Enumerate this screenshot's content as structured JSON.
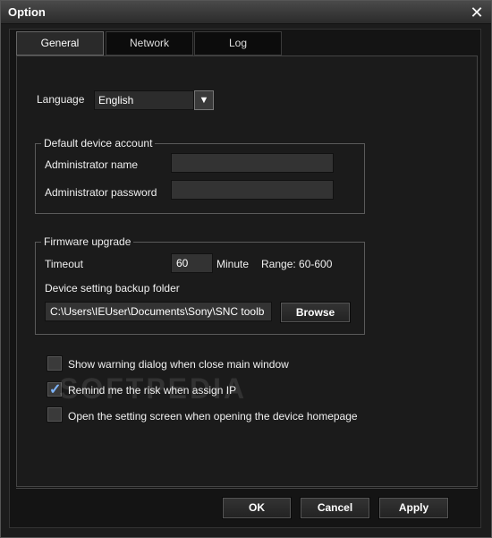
{
  "window": {
    "title": "Option",
    "close_symbol": "✕"
  },
  "tabs": [
    {
      "label": "General",
      "active": true
    },
    {
      "label": "Network",
      "active": false
    },
    {
      "label": "Log",
      "active": false
    }
  ],
  "language": {
    "label": "Language",
    "value": "English",
    "arrow": "▼"
  },
  "default_account": {
    "title": "Default device account",
    "admin_name_label": "Administrator name",
    "admin_name_value": "",
    "admin_password_label": "Administrator password",
    "admin_password_value": ""
  },
  "firmware": {
    "title": "Firmware upgrade",
    "timeout_label": "Timeout",
    "timeout_value": "60",
    "timeout_unit": "Minute",
    "range_text": "Range: 60-600",
    "backup_label": "Device setting backup folder",
    "backup_path": "C:\\Users\\IEUser\\Documents\\Sony\\SNC toolb",
    "browse_label": "Browse"
  },
  "options": [
    {
      "label": "Show warning dialog when close main window",
      "checked": false
    },
    {
      "label": "Remind me the risk when assign IP",
      "checked": true
    },
    {
      "label": "Open the setting screen when opening the device homepage",
      "checked": false
    }
  ],
  "footer": {
    "ok_label": "OK",
    "cancel_label": "Cancel",
    "apply_label": "Apply"
  },
  "watermark": "SOFTPEDIA",
  "colors": {
    "background": "#1b1b1b",
    "titlebar": "#3a3a3a",
    "check_accent": "#7fb6ff"
  }
}
